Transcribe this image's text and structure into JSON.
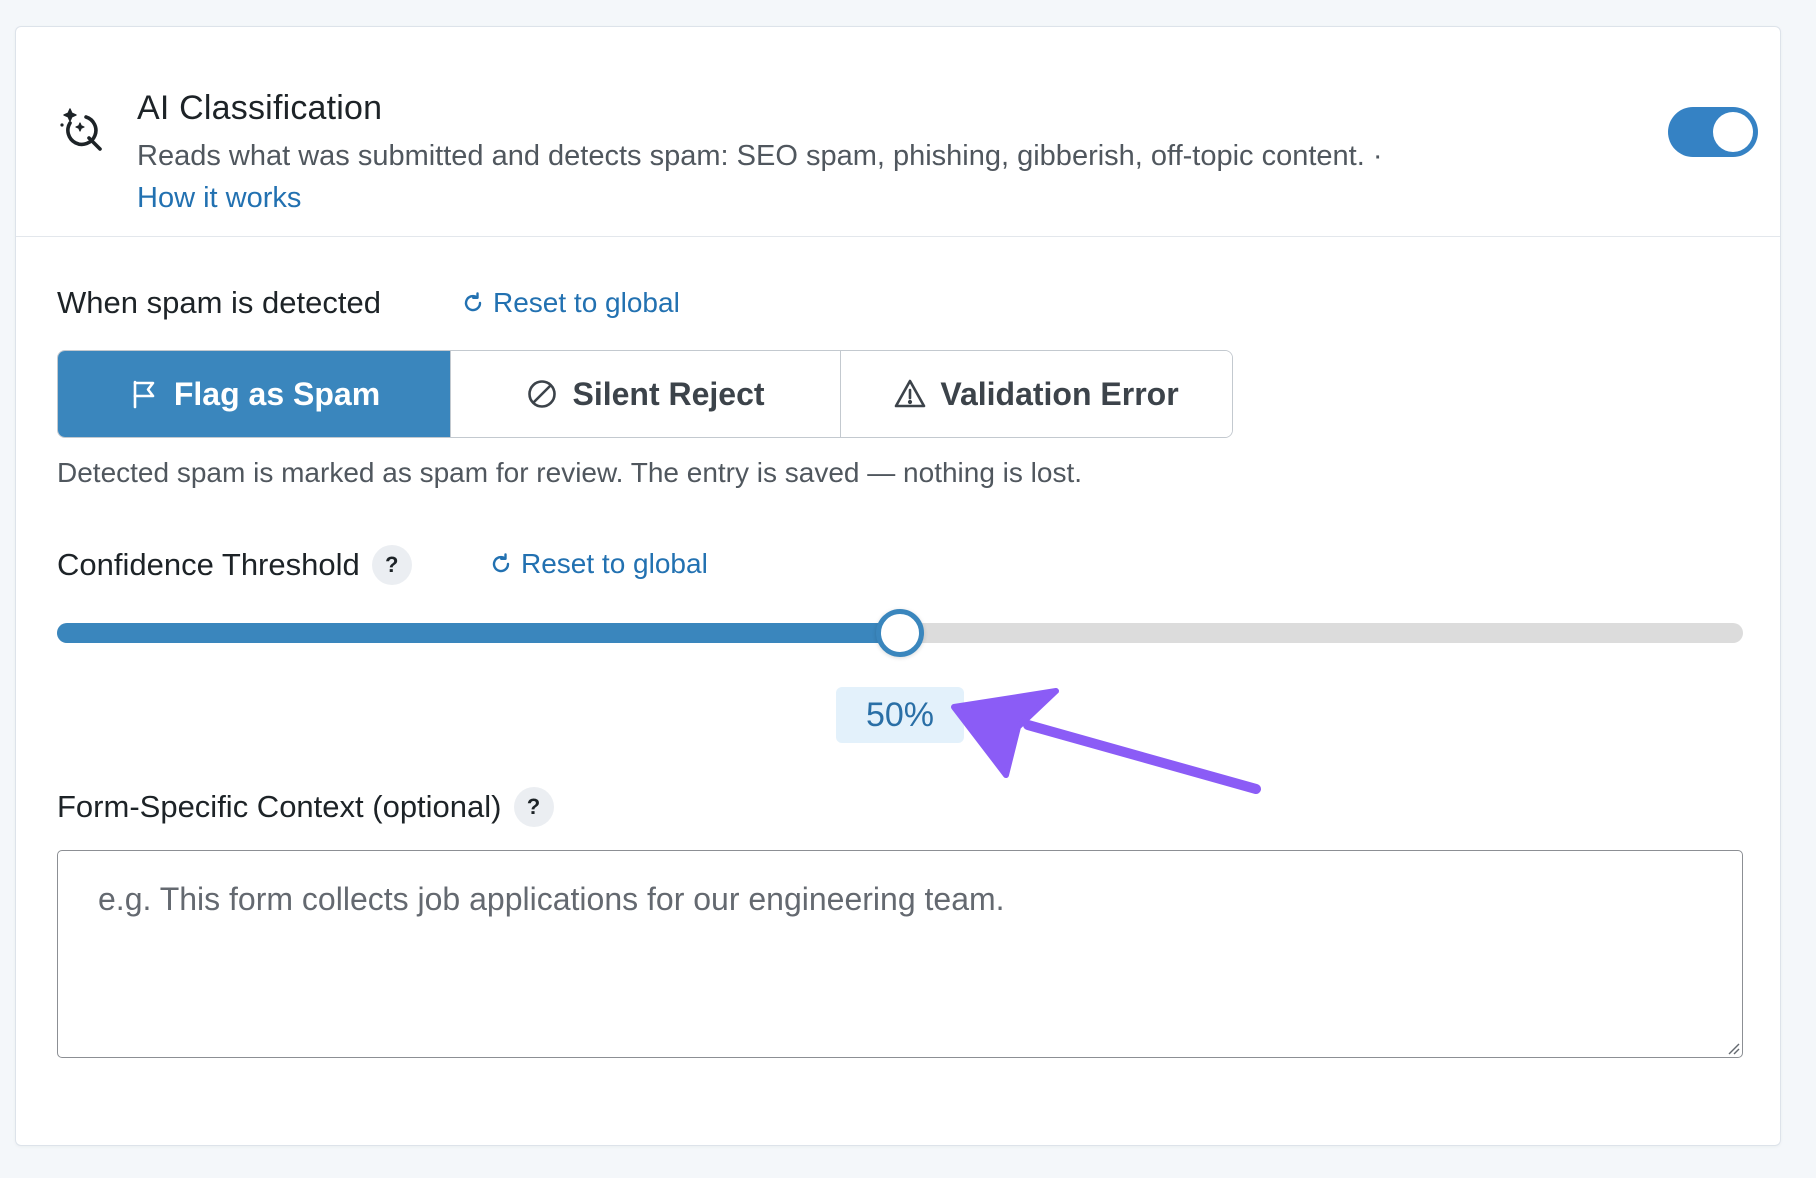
{
  "header": {
    "title": "AI Classification",
    "description": "Reads what was submitted and detects spam: SEO spam, phishing, gibberish, off-topic content.",
    "separator": "·",
    "link_label": "How it works",
    "toggle_enabled": true
  },
  "spam_action": {
    "label": "When spam is detected",
    "reset_label": "Reset to global",
    "options": [
      {
        "label": "Flag as Spam",
        "icon": "flag-icon",
        "active": true
      },
      {
        "label": "Silent Reject",
        "icon": "ban-icon",
        "active": false
      },
      {
        "label": "Validation Error",
        "icon": "warning-icon",
        "active": false
      }
    ],
    "help_text": "Detected spam is marked as spam for review. The entry is saved — nothing is lost."
  },
  "confidence": {
    "label": "Confidence Threshold",
    "help_badge": "?",
    "reset_label": "Reset to global",
    "value": 50,
    "value_label": "50%"
  },
  "context": {
    "label": "Form-Specific Context (optional)",
    "help_badge": "?",
    "placeholder": "e.g. This form collects job applications for our engineering team.",
    "value": ""
  },
  "colors": {
    "accent": "#3a86bd",
    "link": "#2271b1",
    "annotation_arrow": "#8b5cf6"
  }
}
